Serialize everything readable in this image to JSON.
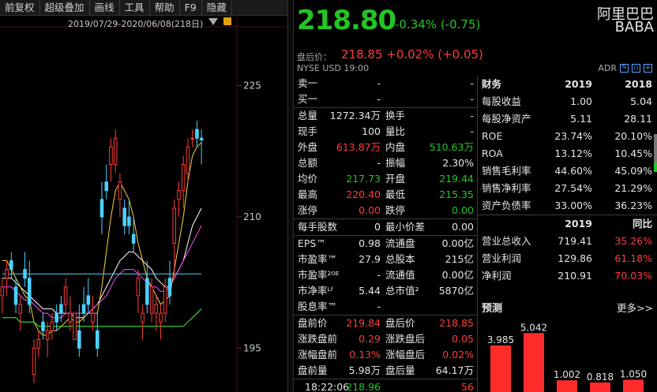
{
  "toolbar": {
    "items": [
      "前复权",
      "超级叠加",
      "画线",
      "工具",
      "帮助",
      "F9",
      "隐藏"
    ]
  },
  "chart": {
    "date_range": "2019/07/29-2020/06/08(218日)",
    "y_labels": [
      "225",
      "210",
      "195"
    ]
  },
  "chart_data": {
    "type": "candlestick",
    "ylim": [
      190,
      231
    ],
    "y_ticks": [
      225,
      210,
      195
    ],
    "candles": [
      {
        "o": 201,
        "h": 203,
        "l": 199,
        "c": 202
      },
      {
        "o": 203,
        "h": 205,
        "l": 201,
        "c": 204
      },
      {
        "o": 205,
        "h": 206,
        "l": 203,
        "c": 204
      },
      {
        "o": 202,
        "h": 203,
        "l": 199,
        "c": 200
      },
      {
        "o": 199,
        "h": 201,
        "l": 197,
        "c": 200
      },
      {
        "o": 204,
        "h": 206,
        "l": 202,
        "c": 203
      },
      {
        "o": 203,
        "h": 205,
        "l": 199,
        "c": 200
      },
      {
        "o": 192,
        "h": 196,
        "l": 191,
        "c": 195
      },
      {
        "o": 195,
        "h": 197,
        "l": 194,
        "c": 196
      },
      {
        "o": 198,
        "h": 199,
        "l": 196,
        "c": 197
      },
      {
        "o": 196,
        "h": 198,
        "l": 194,
        "c": 197
      },
      {
        "o": 197,
        "h": 199,
        "l": 196,
        "c": 198
      },
      {
        "o": 199,
        "h": 200,
        "l": 197,
        "c": 198
      },
      {
        "o": 200,
        "h": 201,
        "l": 198,
        "c": 199
      },
      {
        "o": 200,
        "h": 203,
        "l": 199,
        "c": 202
      },
      {
        "o": 198,
        "h": 201,
        "l": 197,
        "c": 199
      },
      {
        "o": 196,
        "h": 199,
        "l": 196,
        "c": 199
      },
      {
        "o": 197,
        "h": 200,
        "l": 194,
        "c": 195
      },
      {
        "o": 200,
        "h": 202,
        "l": 198,
        "c": 199
      },
      {
        "o": 201,
        "h": 203,
        "l": 199,
        "c": 200
      },
      {
        "o": 198,
        "h": 201,
        "l": 197,
        "c": 199
      },
      {
        "o": 197,
        "h": 199,
        "l": 194,
        "c": 195
      },
      {
        "o": 212,
        "h": 214,
        "l": 208,
        "c": 210
      },
      {
        "o": 214,
        "h": 216,
        "l": 212,
        "c": 213
      },
      {
        "o": 216,
        "h": 219,
        "l": 214,
        "c": 218
      },
      {
        "o": 216,
        "h": 220,
        "l": 215,
        "c": 219
      },
      {
        "o": 212,
        "h": 215,
        "l": 210,
        "c": 214
      },
      {
        "o": 211,
        "h": 212,
        "l": 208,
        "c": 209
      },
      {
        "o": 210,
        "h": 212,
        "l": 208,
        "c": 209
      },
      {
        "o": 208,
        "h": 210,
        "l": 206,
        "c": 207
      },
      {
        "o": 201,
        "h": 204,
        "l": 199,
        "c": 203
      },
      {
        "o": 198,
        "h": 200,
        "l": 196,
        "c": 199
      },
      {
        "o": 203,
        "h": 205,
        "l": 199,
        "c": 200
      },
      {
        "o": 199,
        "h": 203,
        "l": 198,
        "c": 202
      },
      {
        "o": 199,
        "h": 201,
        "l": 197,
        "c": 200
      },
      {
        "o": 198,
        "h": 200,
        "l": 196,
        "c": 199
      },
      {
        "o": 199,
        "h": 203,
        "l": 198,
        "c": 202
      },
      {
        "o": 203,
        "h": 205,
        "l": 200,
        "c": 201
      },
      {
        "o": 207,
        "h": 212,
        "l": 203,
        "c": 211
      },
      {
        "o": 212,
        "h": 214,
        "l": 210,
        "c": 213
      },
      {
        "o": 213,
        "h": 217,
        "l": 211,
        "c": 216
      },
      {
        "o": 215,
        "h": 219,
        "l": 214,
        "c": 218
      },
      {
        "o": 219,
        "h": 220,
        "l": 218,
        "c": 219
      },
      {
        "o": 220,
        "h": 221,
        "l": 218,
        "c": 219
      },
      {
        "o": 219,
        "h": 220,
        "l": 216,
        "c": 218.8
      }
    ],
    "moving_averages": [
      {
        "color": "#ffffff",
        "values": [
          203,
          203,
          203,
          202.5,
          202,
          201.5,
          201,
          200.5,
          200,
          199.5,
          199.5,
          199.5,
          199,
          199,
          199,
          199,
          198.5,
          198.5,
          198.5,
          199,
          199.5,
          200,
          201,
          202,
          203,
          204,
          205,
          205.5,
          206,
          206,
          205.5,
          205,
          204.5,
          204,
          203,
          202.5,
          202,
          202,
          203,
          204,
          205,
          207,
          209,
          210,
          211
        ]
      },
      {
        "color": "#ffd23c",
        "values": [
          205,
          205,
          204,
          203,
          202,
          201,
          200.5,
          198,
          197,
          196.5,
          196.5,
          197,
          197,
          197.5,
          198,
          198.5,
          198,
          198,
          198.5,
          199,
          199,
          199,
          202,
          206,
          210,
          213,
          214,
          213,
          212,
          210,
          207,
          205,
          203,
          202,
          201,
          200,
          200.5,
          201,
          204,
          207,
          210,
          214,
          217,
          218,
          218.5
        ]
      },
      {
        "color": "#ff4bff",
        "values": [
          202,
          202,
          202,
          201.5,
          201,
          200.5,
          200.5,
          200,
          199.5,
          199,
          199,
          198.5,
          198.5,
          198.5,
          199,
          199,
          199,
          199,
          199,
          199,
          199.5,
          200,
          200.5,
          201,
          202,
          203,
          203.5,
          204,
          204,
          204,
          203.5,
          203,
          202.5,
          202,
          202,
          201.5,
          201.5,
          202,
          203,
          204,
          205,
          206,
          207,
          208,
          209
        ]
      },
      {
        "color": "#3cff3c",
        "values": [
          198.5,
          198.5,
          198.5,
          198.5,
          198,
          198,
          198,
          198,
          197.5,
          197.5,
          197.5,
          197.5,
          197.5,
          197.5,
          197.5,
          197.5,
          197.5,
          197.5,
          197.5,
          197.5,
          197.5,
          197.5,
          197.5,
          197.5,
          197.5,
          197.5,
          197.5,
          197.5,
          197.5,
          197.5,
          197.5,
          197.5,
          197.5,
          197.5,
          197.5,
          197.5,
          197.5,
          197.5,
          197.5,
          197.5,
          197.5,
          198,
          198.5,
          199,
          199.5
        ]
      },
      {
        "color": "#4bd2ff",
        "values": [
          203.5,
          203.5,
          203.5,
          203.5,
          203.5,
          203.5,
          203.5,
          203.5,
          203.5,
          203.5,
          203.5,
          203.5,
          203.5,
          203.5,
          203.5,
          203.5,
          203.5,
          203.5,
          203.5,
          203.5,
          203.5,
          203.5,
          203.5,
          203.5,
          203.5,
          203.5,
          203.5,
          203.5,
          203.5,
          203.5,
          203.5,
          203.5,
          203.5,
          203.5,
          203.5,
          203.5,
          203.5,
          203.5,
          203.5,
          203.5,
          203.5,
          203.5,
          203.5,
          203.5,
          203.5
        ]
      }
    ],
    "forecast": {
      "type": "bar",
      "values": [
        3.985,
        5.042,
        1.002,
        0.818,
        1.05
      ],
      "labels": [
        "3.985",
        "5.042",
        "1.002",
        "0.818",
        "1.050"
      ],
      "ylim": [
        0,
        5.6
      ]
    }
  },
  "quote": {
    "price": "218.80",
    "change": "-0.34% (-0.75)",
    "name_cn": "阿里巴巴",
    "ticker": "BABA",
    "ah_label": "盘后价：",
    "ah_price": "218.85 +0.02% (+0.05)",
    "exchange_line": "NYSE   USD   19:00",
    "adr_label": "ADR"
  },
  "left_rows": [
    {
      "l1": "卖一",
      "v1": "-",
      "l2": "",
      "v2": "-",
      "c1": "white",
      "c2": "white",
      "sep_after": false
    },
    {
      "l1": "买一",
      "v1": "-",
      "l2": "",
      "v2": "-",
      "c1": "white",
      "c2": "white",
      "sep_after": true
    },
    {
      "l1": "总量",
      "v1": "1272.34万",
      "l2": "换手",
      "v2": "-",
      "c1": "white",
      "c2": "white",
      "sep_after": false
    },
    {
      "l1": "现手",
      "v1": "100",
      "l2": "量比",
      "v2": "-",
      "c1": "white",
      "c2": "white",
      "sep_after": false
    },
    {
      "l1": "外盘",
      "v1": "613.87万",
      "l2": "内盘",
      "v2": "510.63万",
      "c1": "up",
      "c2": "down",
      "sep_after": false
    },
    {
      "l1": "总额",
      "v1": "-",
      "l2": "振幅",
      "v2": "2.30%",
      "c1": "white",
      "c2": "white",
      "sep_after": false
    },
    {
      "l1": "均价",
      "v1": "217.73",
      "l2": "开盘",
      "v2": "219.44",
      "c1": "down",
      "c2": "down",
      "sep_after": false
    },
    {
      "l1": "最高",
      "v1": "220.40",
      "l2": "最低",
      "v2": "215.35",
      "c1": "up",
      "c2": "down",
      "sep_after": false
    },
    {
      "l1": "涨停",
      "v1": "0.00",
      "l2": "跌停",
      "v2": "0.00",
      "c1": "up",
      "c2": "down",
      "sep_after": true
    },
    {
      "l1": "每手股数",
      "v1": "0",
      "l2": "最小价差",
      "v2": "0.00",
      "c1": "white",
      "c2": "white",
      "sep_after": true
    },
    {
      "l1": "EPS™",
      "v1": "0.98",
      "l2": "流通盘",
      "v2": "0.00亿",
      "c1": "white",
      "c2": "white",
      "sep_after": false
    },
    {
      "l1": "市盈率™",
      "v1": "27.9",
      "l2": "总股本",
      "v2": "215亿",
      "c1": "white",
      "c2": "white",
      "sep_after": false
    },
    {
      "l1": "市盈率²⁰ᴱ",
      "v1": "-",
      "l2": "流通值",
      "v2": "0.00亿",
      "c1": "white",
      "c2": "white",
      "sep_after": false
    },
    {
      "l1": "市净率ᴸᶠ",
      "v1": "5.44",
      "l2": "总市值²",
      "v2": "5870亿",
      "c1": "white",
      "c2": "white",
      "sep_after": false
    },
    {
      "l1": "股息率™",
      "v1": "-",
      "l2": "",
      "v2": "",
      "c1": "white",
      "c2": "white",
      "sep_after": true
    },
    {
      "l1": "盘前价",
      "v1": "219.84",
      "l2": "盘后价",
      "v2": "218.85",
      "c1": "up",
      "c2": "up",
      "sep_after": false
    },
    {
      "l1": "涨跌盘前",
      "v1": "0.29",
      "l2": "涨跌盘后",
      "v2": "0.05",
      "c1": "up",
      "c2": "up",
      "sep_after": false
    },
    {
      "l1": "涨幅盘前",
      "v1": "0.13%",
      "l2": "涨幅盘后",
      "v2": "0.02%",
      "c1": "up",
      "c2": "up",
      "sep_after": false
    },
    {
      "l1": "盘前量",
      "v1": "5.98万",
      "l2": "盘后量",
      "v2": "64.17万",
      "c1": "white",
      "c2": "white",
      "sep_after": true
    }
  ],
  "tick_row": {
    "time": "18:22:06",
    "price": "218.96",
    "vol": "56"
  },
  "fin": {
    "header": {
      "label": "财务",
      "c1": "2019",
      "c2": "2018"
    },
    "rows": [
      {
        "label": "每股收益",
        "c1": "1.00",
        "c2": "5.04",
        "cls": "white"
      },
      {
        "label": "每股净资产",
        "c1": "5.11",
        "c2": "28.11",
        "cls": "white"
      },
      {
        "label": "ROE",
        "c1": "23.74%",
        "c2": "20.10%",
        "cls": "white"
      },
      {
        "label": "ROA",
        "c1": "13.12%",
        "c2": "10.45%",
        "cls": "white"
      },
      {
        "label": "销售毛利率",
        "c1": "44.60%",
        "c2": "45.09%",
        "cls": "white"
      },
      {
        "label": "销售净利率",
        "c1": "27.54%",
        "c2": "21.29%",
        "cls": "white"
      },
      {
        "label": "资产负债率",
        "c1": "33.00%",
        "c2": "36.23%",
        "cls": "white"
      }
    ],
    "header2": {
      "label": "",
      "c1": "2019",
      "c2": "同比"
    },
    "rows2": [
      {
        "label": "营业总收入",
        "c1": "719.41",
        "c2": "35.26%"
      },
      {
        "label": "营业利润",
        "c1": "129.86",
        "c2": "61.18%"
      },
      {
        "label": "净利润",
        "c1": "210.91",
        "c2": "70.03%"
      }
    ],
    "forecast_label": "预测",
    "more_label": "更多>>"
  }
}
